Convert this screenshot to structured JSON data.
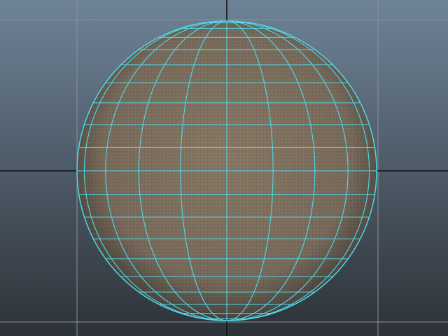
{
  "viewport": {
    "view": "front",
    "shading": "smooth-shade-with-wireframe",
    "selected_object": "sphere",
    "background_top": "#6e8397",
    "background_bottom": "#2d3238"
  },
  "grid": {
    "line_color": "#8a929c",
    "axis_color": "#111111"
  },
  "sphere": {
    "selected": true,
    "subdivisions_axis": 20,
    "subdivisions_height": 20,
    "surface_color_light": "#8a7a66",
    "surface_color_dark": "#3e3a36",
    "wire_color": "#4fd6e8"
  }
}
